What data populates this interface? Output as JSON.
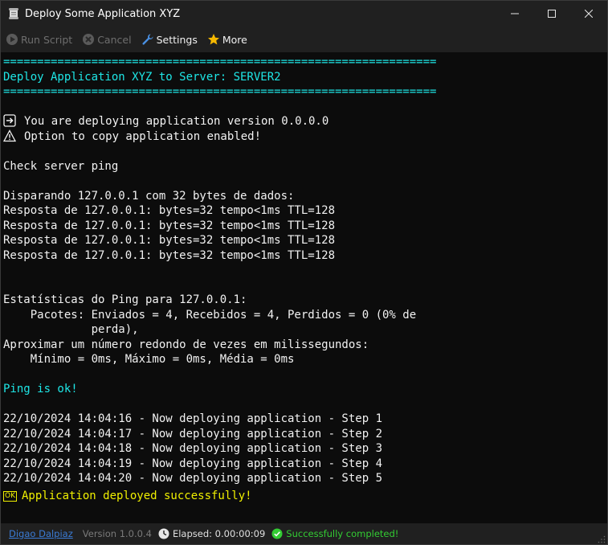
{
  "window": {
    "title": "Deploy Some Application XYZ",
    "minimize_glyph": "—",
    "maximize_glyph": "☐",
    "close_glyph": "✕"
  },
  "toolbar": {
    "run_label": "Run Script",
    "cancel_label": "Cancel",
    "settings_label": "Settings",
    "more_label": "More"
  },
  "console": {
    "separator": "================================================================",
    "header": "Deploy Application XYZ to Server: SERVER2",
    "version_line": "You are deploying application version 0.0.0.0",
    "copy_line": "Option to copy application enabled!",
    "check_ping": "Check server ping",
    "ping_intro": "Disparando 127.0.0.1 com 32 bytes de dados:",
    "ping_replies": [
      "Resposta de 127.0.0.1: bytes=32 tempo<1ms TTL=128",
      "Resposta de 127.0.0.1: bytes=32 tempo<1ms TTL=128",
      "Resposta de 127.0.0.1: bytes=32 tempo<1ms TTL=128",
      "Resposta de 127.0.0.1: bytes=32 tempo<1ms TTL=128"
    ],
    "stats_title": "Estatísticas do Ping para 127.0.0.1:",
    "stats_packets_1": "    Pacotes: Enviados = 4, Recebidos = 4, Perdidos = 0 (0% de",
    "stats_packets_2": "             perda),",
    "stats_approx": "Aproximar um número redondo de vezes em milissegundos:",
    "stats_times": "    Mínimo = 0ms, Máximo = 0ms, Média = 0ms",
    "ping_ok": "Ping is ok!",
    "steps": [
      "22/10/2024 14:04:16 - Now deploying application - Step 1",
      "22/10/2024 14:04:17 - Now deploying application - Step 2",
      "22/10/2024 14:04:18 - Now deploying application - Step 3",
      "22/10/2024 14:04:19 - Now deploying application - Step 4",
      "22/10/2024 14:04:20 - Now deploying application - Step 5"
    ],
    "ok_badge": "OK",
    "final_message": "Application deployed successfully!"
  },
  "statusbar": {
    "author": "Digao Dalpiaz",
    "version": "Version 1.0.0.4",
    "elapsed": "Elapsed: 0.00:00:09",
    "status": "Successfully completed!"
  },
  "colors": {
    "cyan": "#1ee6e6",
    "yellow": "#f0f000",
    "success_green": "#33cc33",
    "link_blue": "#3a7bd5"
  }
}
